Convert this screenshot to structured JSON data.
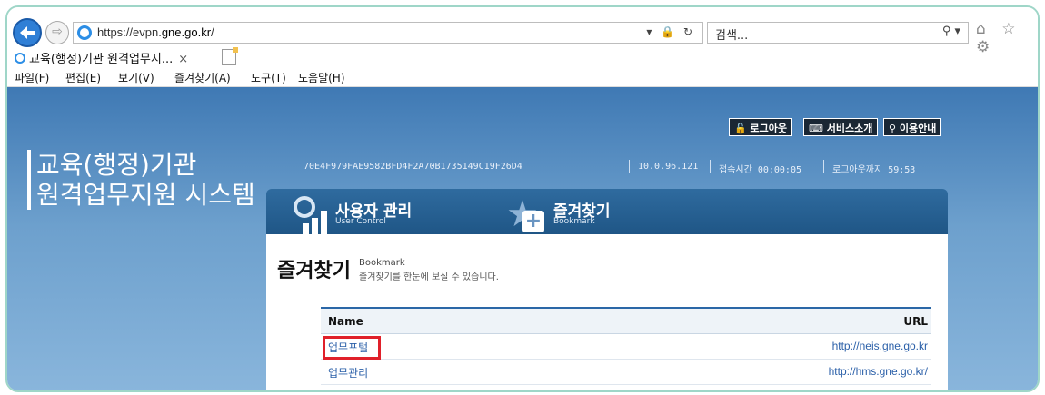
{
  "browser": {
    "url_prefix": "https://evpn.",
    "url_domain": "gne.go.kr",
    "url_suffix": "/",
    "url_icons": "▾ 🔒 ↻",
    "search_placeholder": "검색...",
    "search_icon": "⚲ ▾",
    "right_glyphs": "⌂ ☆ ⚙",
    "tab_title": "교육(행정)기관 원격업무지...",
    "tab_close": "×",
    "fwd_glyph": "⇨",
    "menu": [
      "파일(F)",
      "편집(E)",
      "보기(V)",
      "즐겨찾기(A)",
      "도구(T)",
      "도움말(H)"
    ]
  },
  "header": {
    "buttons": [
      "로그아웃",
      "서비스소개",
      "이용안내"
    ],
    "button_icons": [
      "🔓",
      "⌨",
      "⚲"
    ],
    "system_name_line1": "교육(행정)기관",
    "system_name_line2": "원격업무지원 시스템",
    "session_id": "70E4F979FAE9582BFD4F2A70B1735149C19F26D4",
    "ip": "10.0.96.121",
    "connect_time": "접속시간 00:00:05",
    "logout_remaining": "로그아웃까지 59:53"
  },
  "nav": {
    "tabs": [
      {
        "label": "사용자 관리",
        "sub": "User Control",
        "icon": "user-control-icon"
      },
      {
        "label": "즐겨찾기",
        "sub": "Bookmark",
        "icon": "bookmark-icon"
      }
    ]
  },
  "content": {
    "title": "즐겨찾기",
    "title_en": "Bookmark",
    "description": "즐겨찾기를 한눈에 보실 수 있습니다.",
    "columns": {
      "name": "Name",
      "url": "URL"
    },
    "rows": [
      {
        "name": "업무포털",
        "url": "http://neis.gne.go.kr"
      },
      {
        "name": "업무관리",
        "url": "http://hms.gne.go.kr/"
      }
    ]
  }
}
